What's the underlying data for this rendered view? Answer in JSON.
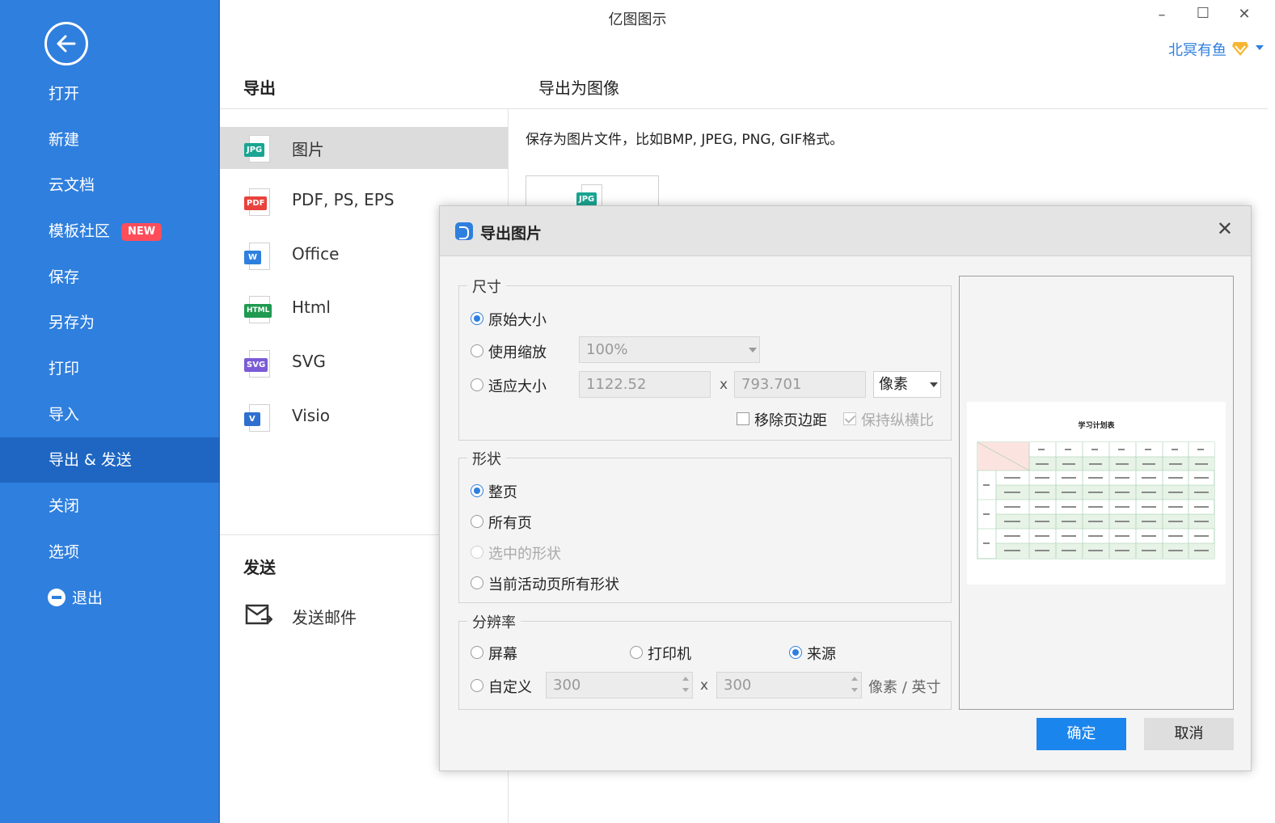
{
  "window": {
    "title": "亿图图示",
    "minimize": "–",
    "maximize": "☐",
    "close": "✕"
  },
  "user": {
    "name": "北冥有鱼"
  },
  "sidebar": {
    "items": [
      {
        "label": "打开"
      },
      {
        "label": "新建"
      },
      {
        "label": "云文档"
      },
      {
        "label": "模板社区",
        "badge": "NEW"
      },
      {
        "label": "保存"
      },
      {
        "label": "另存为"
      },
      {
        "label": "打印"
      },
      {
        "label": "导入"
      },
      {
        "label": "导出 & 发送"
      },
      {
        "label": "关闭"
      },
      {
        "label": "选项"
      },
      {
        "label": "退出"
      }
    ]
  },
  "export": {
    "section_title": "导出",
    "right_title": "导出为图像",
    "description": "保存为图片文件，比如BMP, JPEG, PNG, GIF格式。",
    "formats": [
      {
        "label": "图片",
        "tag": "JPG",
        "color": "#1aa592"
      },
      {
        "label": "PDF, PS, EPS",
        "tag": "PDF",
        "color": "#e8423c"
      },
      {
        "label": "Office",
        "tag": "W",
        "color": "#2f7fde"
      },
      {
        "label": "Html",
        "tag": "HTML",
        "color": "#1f9a50"
      },
      {
        "label": "SVG",
        "tag": "SVG",
        "color": "#7b5bd6"
      },
      {
        "label": "Visio",
        "tag": "V",
        "color": "#2f6fcf"
      }
    ],
    "thumb_tag": "JPG"
  },
  "send": {
    "section_title": "发送",
    "email_label": "发送邮件"
  },
  "dialog": {
    "title": "导出图片",
    "close": "✕",
    "size": {
      "legend": "尺寸",
      "original": "原始大小",
      "use_zoom": "使用缩放",
      "zoom_value": "100%",
      "fit_size": "适应大小",
      "width": "1122.52",
      "x": "x",
      "height": "793.701",
      "unit": "像素",
      "remove_margin": "移除页边距",
      "keep_ratio": "保持纵横比"
    },
    "shape": {
      "legend": "形状",
      "whole_page": "整页",
      "all_pages": "所有页",
      "selected": "选中的形状",
      "current_page": "当前活动页所有形状"
    },
    "resolution": {
      "legend": "分辨率",
      "screen": "屏幕",
      "printer": "打印机",
      "source": "来源",
      "custom": "自定义",
      "x_value": "300",
      "x": "x",
      "y_value": "300",
      "unit": "像素 / 英寸"
    },
    "preview_title": "学习计划表",
    "ok": "确定",
    "cancel": "取消"
  }
}
